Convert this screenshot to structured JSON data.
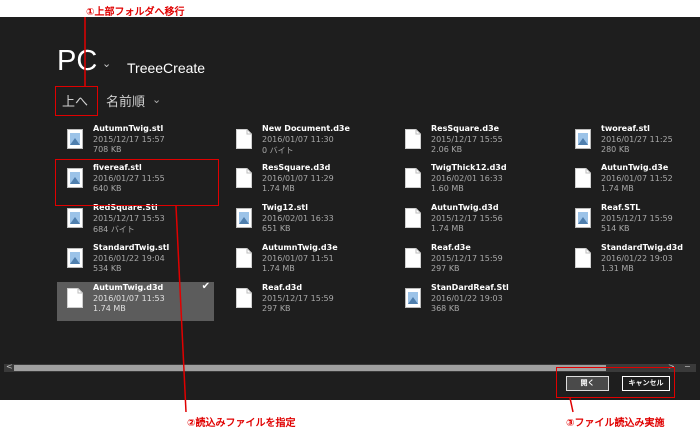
{
  "location": {
    "name": "PC",
    "folder": "TreeeCreate"
  },
  "nav": {
    "up_label": "上へ",
    "sort_label": "名前順"
  },
  "files": [
    {
      "name": "AutumnTwig.stl",
      "date": "2015/12/17 15:57",
      "size": "708 KB",
      "icon": "stl-file-icon"
    },
    {
      "name": "fivereaf.stl",
      "date": "2016/01/27 11:55",
      "size": "640 KB",
      "icon": "stl-file-icon"
    },
    {
      "name": "RedSquare.Stl",
      "date": "2015/12/17 15:53",
      "size": "684 バイト",
      "icon": "stl-file-icon"
    },
    {
      "name": "StandardTwig.stl",
      "date": "2016/01/22 19:04",
      "size": "534 KB",
      "icon": "stl-file-icon"
    },
    {
      "name": "AutumTwig.d3d",
      "date": "2016/01/07 11:53",
      "size": "1.74 MB",
      "icon": "document-icon",
      "selected": true
    },
    {
      "name": "New Document.d3e",
      "date": "2016/01/07 11:30",
      "size": "0 バイト",
      "icon": "document-icon"
    },
    {
      "name": "ResSquare.d3d",
      "date": "2016/01/07 11:29",
      "size": "1.74 MB",
      "icon": "document-icon"
    },
    {
      "name": "Twig12.stl",
      "date": "2016/02/01 16:33",
      "size": "651 KB",
      "icon": "stl-file-icon"
    },
    {
      "name": "AutumnTwig.d3e",
      "date": "2016/01/07 11:51",
      "size": "1.74 MB",
      "icon": "document-icon"
    },
    {
      "name": "Reaf.d3d",
      "date": "2015/12/17 15:59",
      "size": "297 KB",
      "icon": "document-icon"
    },
    {
      "name": "ResSquare.d3e",
      "date": "2015/12/17 15:55",
      "size": "2.06 KB",
      "icon": "document-icon"
    },
    {
      "name": "TwigThick12.d3d",
      "date": "2016/02/01 16:33",
      "size": "1.60 MB",
      "icon": "document-icon"
    },
    {
      "name": "AutunTwig.d3d",
      "date": "2015/12/17 15:56",
      "size": "1.74 MB",
      "icon": "document-icon"
    },
    {
      "name": "Reaf.d3e",
      "date": "2015/12/17 15:59",
      "size": "297 KB",
      "icon": "document-icon"
    },
    {
      "name": "StanDardReaf.Stl",
      "date": "2016/01/22 19:03",
      "size": "368 KB",
      "icon": "stl-file-icon"
    },
    {
      "name": "tworeaf.stl",
      "date": "2016/01/27 11:25",
      "size": "280 KB",
      "icon": "stl-file-icon"
    },
    {
      "name": "AutunTwig.d3e",
      "date": "2016/01/07 11:52",
      "size": "1.74 MB",
      "icon": "document-icon"
    },
    {
      "name": "Reaf.STL",
      "date": "2015/12/17 15:59",
      "size": "514 KB",
      "icon": "stl-file-icon"
    },
    {
      "name": "StandardTwig.d3d",
      "date": "2016/01/22 19:03",
      "size": "1.31 MB",
      "icon": "document-icon"
    }
  ],
  "buttons": {
    "open": "開く",
    "cancel": "キャンセル"
  },
  "annotations": {
    "step1": "①上部フォルダへ移行",
    "step2": "②読込みファイルを指定",
    "step3": "③ファイル読込み実施"
  },
  "colors": {
    "background": "#1e1e1e",
    "selection": "#5c5c5c",
    "annotation": "#e00000"
  }
}
